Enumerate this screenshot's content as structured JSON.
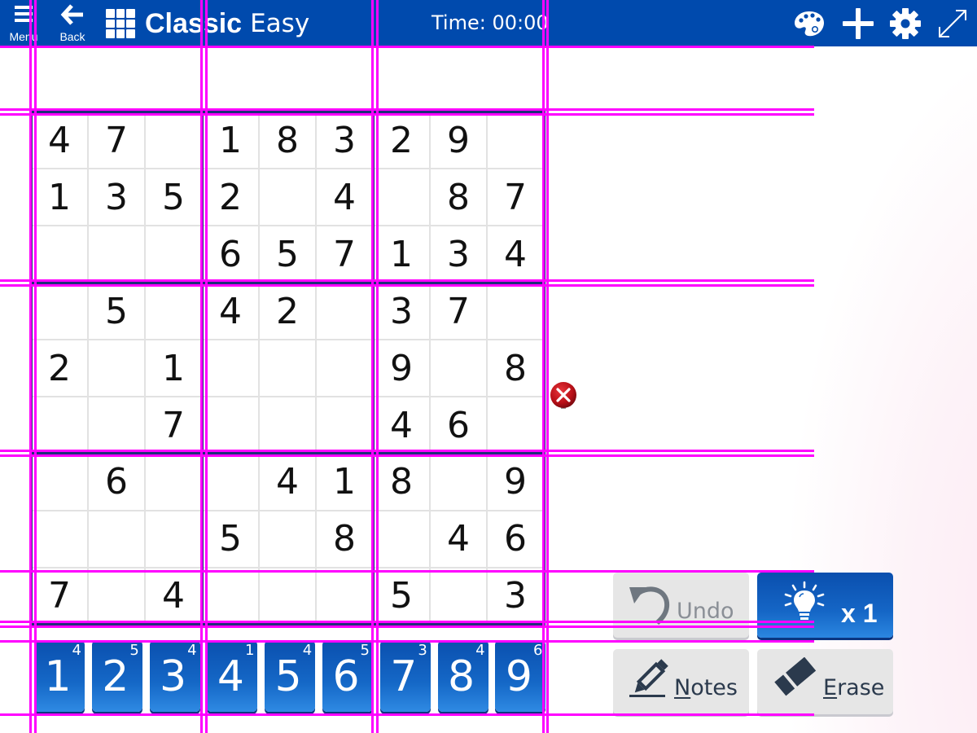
{
  "header": {
    "menu_label": "Menu",
    "back_label": "Back",
    "title_mode": "Classic",
    "title_difficulty": "Easy",
    "timer": "Time: 00:00",
    "icons": [
      "palette-icon",
      "plus-icon",
      "gear-icon",
      "fullscreen-icon"
    ]
  },
  "colors": {
    "header_bg": "#004aad",
    "grid_thick": "#1f2e78",
    "grid_thin": "#e2e2e2",
    "key_blue": "#1568c7",
    "error_red": "#c0141c",
    "overlay_guide": "#ff00ff"
  },
  "board": {
    "rows": [
      [
        "4",
        "7",
        "",
        "1",
        "8",
        "3",
        "2",
        "9",
        ""
      ],
      [
        "1",
        "3",
        "5",
        "2",
        "",
        "4",
        "",
        "8",
        "7"
      ],
      [
        "",
        "",
        "",
        "6",
        "5",
        "7",
        "1",
        "3",
        "4"
      ],
      [
        "",
        "5",
        "",
        "4",
        "2",
        "",
        "3",
        "7",
        ""
      ],
      [
        "2",
        "",
        "1",
        "",
        "",
        "",
        "9",
        "",
        "8"
      ],
      [
        "",
        "",
        "7",
        "",
        "",
        "",
        "4",
        "6",
        ""
      ],
      [
        "",
        "6",
        "",
        "",
        "4",
        "1",
        "8",
        "",
        "9"
      ],
      [
        "",
        "",
        "",
        "5",
        "",
        "8",
        "",
        "4",
        "6"
      ],
      [
        "7",
        "",
        "4",
        "",
        "",
        "",
        "5",
        "",
        "3"
      ]
    ],
    "error_indicator_row": 5
  },
  "numpad": {
    "keys": [
      {
        "digit": "1",
        "remaining": "4"
      },
      {
        "digit": "2",
        "remaining": "5"
      },
      {
        "digit": "3",
        "remaining": "4"
      },
      {
        "digit": "4",
        "remaining": "1"
      },
      {
        "digit": "5",
        "remaining": "4"
      },
      {
        "digit": "6",
        "remaining": "5"
      },
      {
        "digit": "7",
        "remaining": "3"
      },
      {
        "digit": "8",
        "remaining": "4"
      },
      {
        "digit": "9",
        "remaining": "6"
      }
    ]
  },
  "actions": {
    "undo": {
      "label_first": "U",
      "label_rest": "ndo",
      "enabled": false
    },
    "hint": {
      "label": "x 1"
    },
    "notes": {
      "label_first": "N",
      "label_rest": "otes"
    },
    "erase": {
      "label_first": "E",
      "label_rest": "rase"
    }
  }
}
